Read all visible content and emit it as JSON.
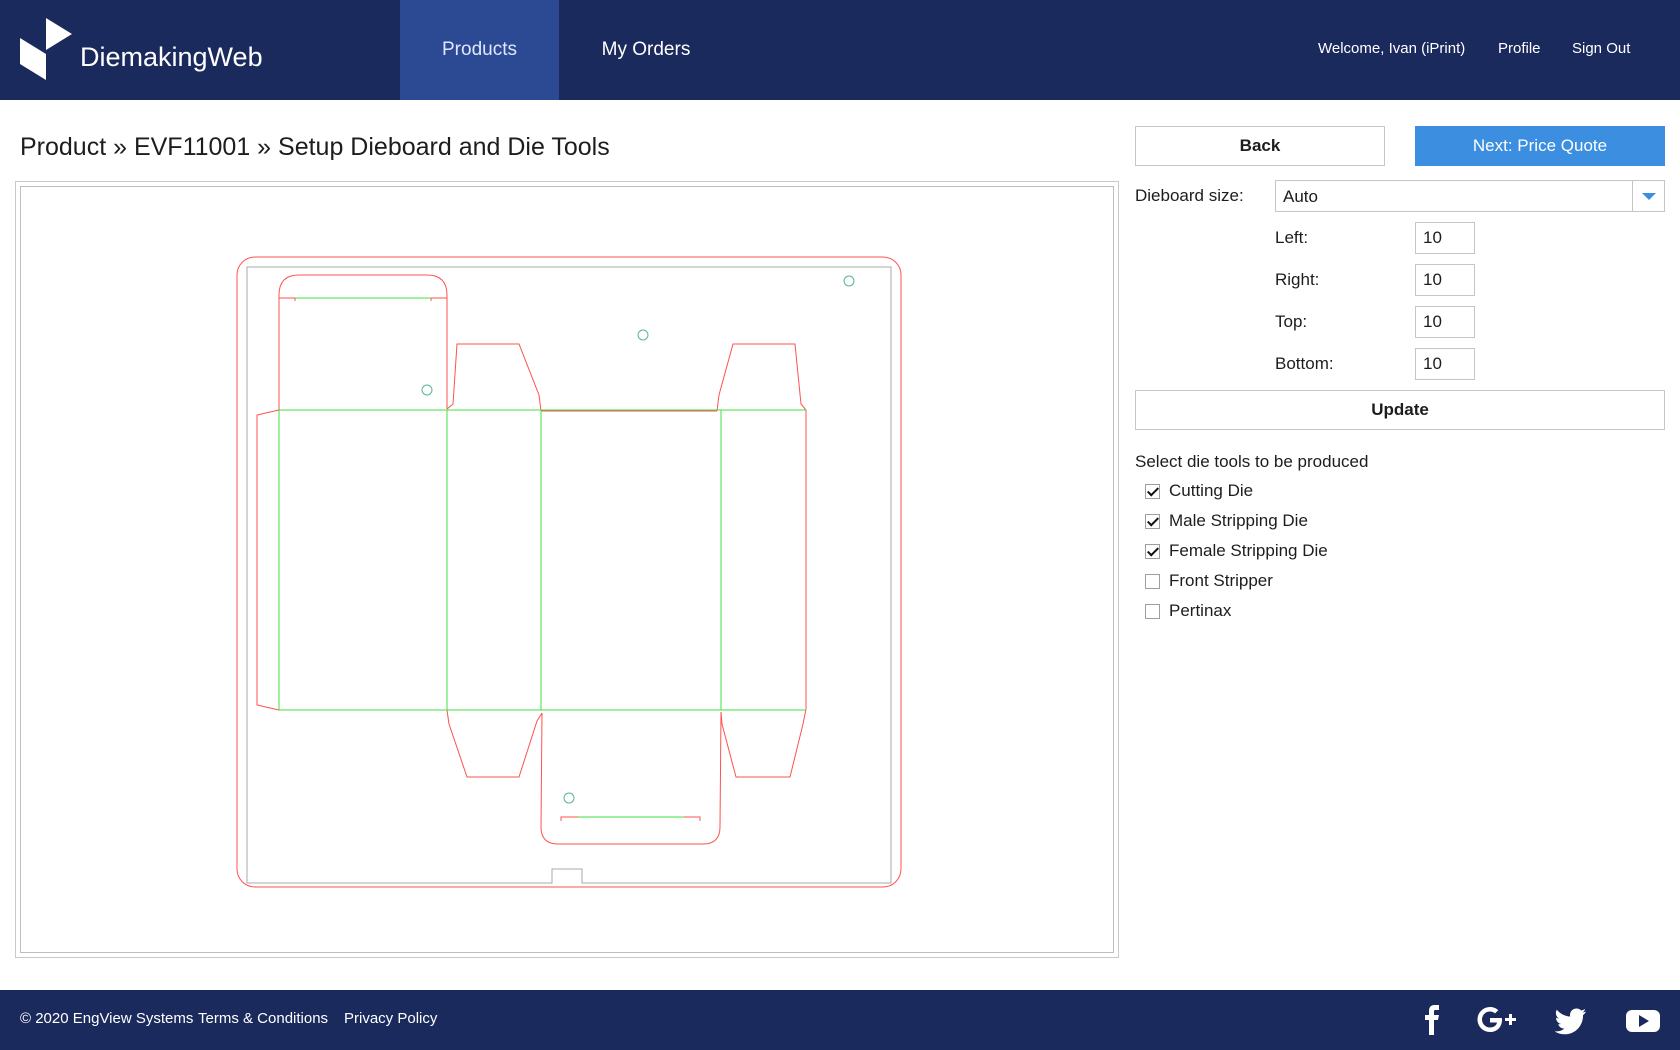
{
  "header": {
    "brand": "DiemakingWeb",
    "nav": [
      {
        "label": "Products",
        "active": true
      },
      {
        "label": "My Orders",
        "active": false
      }
    ],
    "welcome": "Welcome, Ivan (iPrint)",
    "profile": "Profile",
    "sign_out": "Sign Out"
  },
  "page": {
    "title": "Product » EVF11001 » Setup Dieboard and Die Tools"
  },
  "actions": {
    "back": "Back",
    "next": "Next: Price Quote",
    "update": "Update"
  },
  "dieboard": {
    "size_label": "Dieboard size:",
    "size_value": "Auto",
    "margins": [
      {
        "label": "Left:",
        "value": "10"
      },
      {
        "label": "Right:",
        "value": "10"
      },
      {
        "label": "Top:",
        "value": "10"
      },
      {
        "label": "Bottom:",
        "value": "10"
      }
    ]
  },
  "die_tools": {
    "label": "Select die tools to be produced",
    "items": [
      {
        "label": "Cutting Die",
        "checked": true
      },
      {
        "label": "Male Stripping Die",
        "checked": true
      },
      {
        "label": "Female Stripping Die",
        "checked": true
      },
      {
        "label": "Front Stripper",
        "checked": false
      },
      {
        "label": "Pertinax",
        "checked": false
      }
    ]
  },
  "footer": {
    "copyright": "© 2020 EngView Systems",
    "terms": "Terms & Conditions",
    "privacy": "Privacy Policy",
    "social": [
      "facebook-icon",
      "google-plus-icon",
      "twitter-icon",
      "youtube-icon"
    ]
  },
  "colors": {
    "header_bg": "#1b2a5c",
    "nav_active": "#2c4a94",
    "primary": "#3c8ee0",
    "cut_line": "#ff5050",
    "crease_line": "#40e040"
  }
}
